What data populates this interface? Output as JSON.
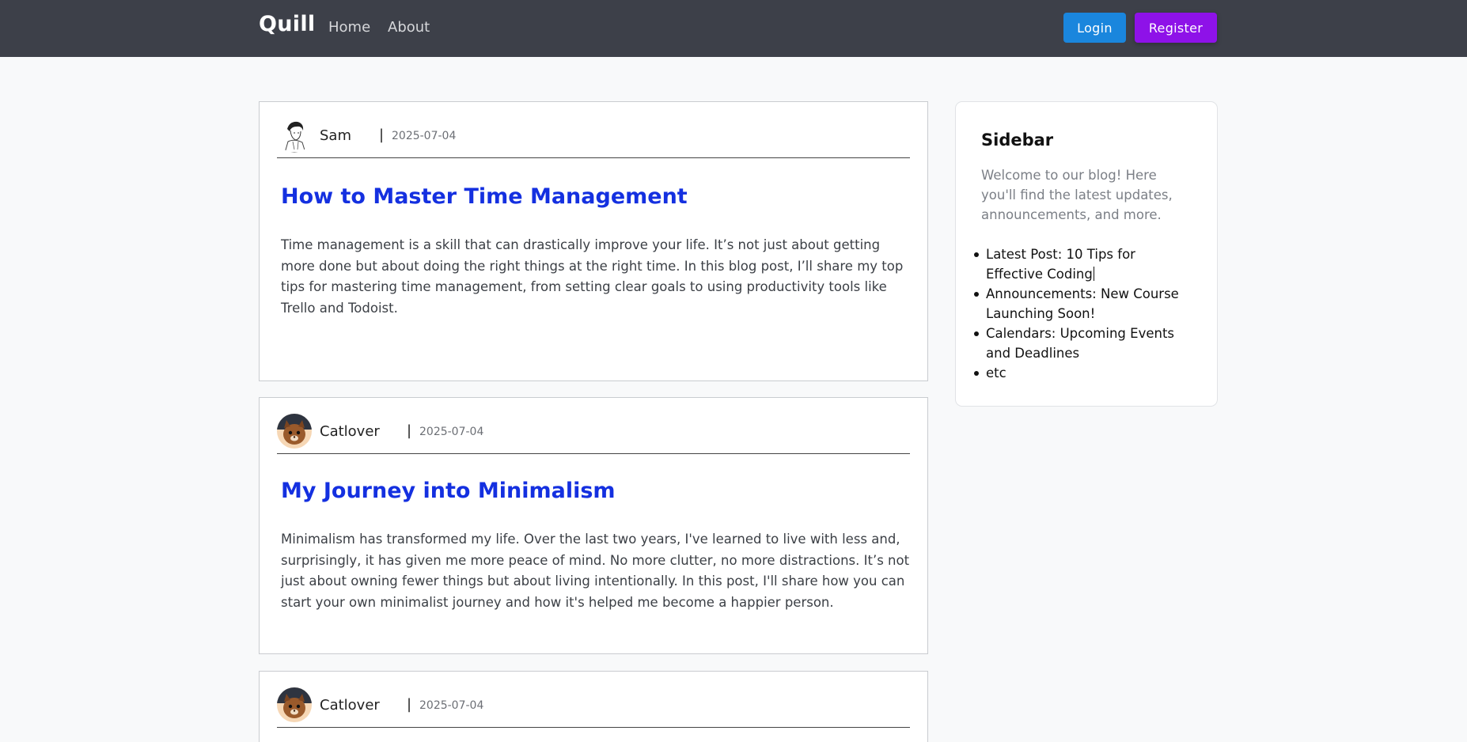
{
  "nav": {
    "brand": "Quill",
    "links": [
      "Home",
      "About"
    ],
    "login_label": "Login",
    "register_label": "Register"
  },
  "posts": [
    {
      "author": "Sam",
      "separator": "|",
      "date": "2025-07-04",
      "title": "How to Master Time Management",
      "body": "Time management is a skill that can drastically improve your life. It’s not just about getting more done but about doing the right things at the right time. In this blog post, I’ll share my top tips for mastering time management, from setting clear goals to using productivity tools like Trello and Todoist."
    },
    {
      "author": "Catlover",
      "separator": "|",
      "date": "2025-07-04",
      "title": "My Journey into Minimalism",
      "body": "Minimalism has transformed my life. Over the last two years, I've learned to live with less and, surprisingly, it has given me more peace of mind. No more clutter, no more distractions. It’s not just about owning fewer things but about living intentionally. In this post, I'll share how you can start your own minimalist journey and how it's helped me become a happier person."
    },
    {
      "author": "Catlover",
      "separator": "|",
      "date": "2025-07-04"
    }
  ],
  "sidebar": {
    "title": "Sidebar",
    "intro": "Welcome to our blog! Here you'll find the latest updates, announcements, and more.",
    "items": [
      "Latest Post: 10 Tips for Effective Coding",
      "Announcements: New Course Launching Soon!",
      "Calendars: Upcoming Events and Deadlines",
      "etc"
    ]
  },
  "colors": {
    "navbar_bg": "#3d4049",
    "login_button": "#1a86dd",
    "register_button": "#8e12e8",
    "post_title": "#1430e0"
  },
  "icons": [
    "sketch-avatar-icon",
    "cat-avatar-icon"
  ]
}
